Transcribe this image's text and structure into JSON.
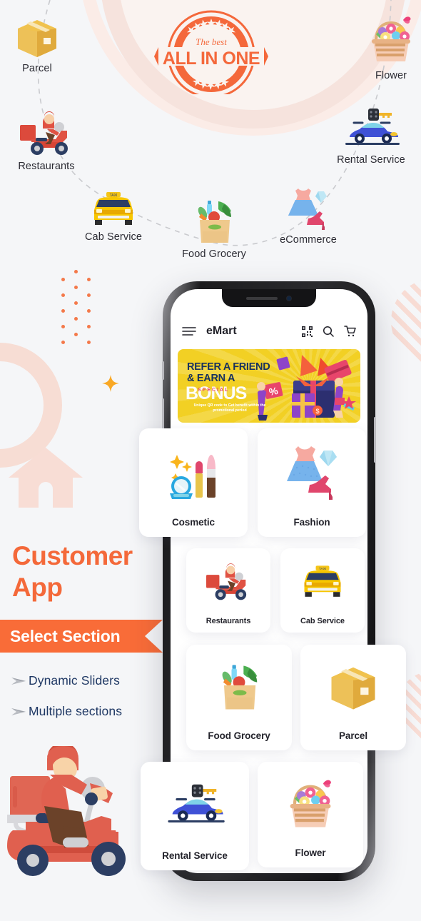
{
  "colors": {
    "accent_orange": "#f96c38",
    "heading_orange": "#f4693a",
    "bullet_blue": "#1f3864",
    "banner_yellow": "#f2d024",
    "page_bg": "#f5f6f8",
    "deco_pink": "#f7ddd4",
    "star_yellow": "#f9a825"
  },
  "badge": {
    "top_text": "The best",
    "main_text": "ALL IN ONE"
  },
  "services": [
    {
      "key": "parcel",
      "label": "Parcel",
      "icon": "parcel-box-icon"
    },
    {
      "key": "rest",
      "label": "Restaurants",
      "icon": "delivery-scooter-icon"
    },
    {
      "key": "cab",
      "label": "Cab Service",
      "icon": "taxi-car-icon"
    },
    {
      "key": "grocery",
      "label": "Food Grocery",
      "icon": "grocery-bag-icon"
    },
    {
      "key": "ecom",
      "label": "eCommerce",
      "icon": "dress-heel-diamond-icon"
    },
    {
      "key": "flower",
      "label": "Flower",
      "icon": "flower-basket-icon"
    },
    {
      "key": "rental",
      "label": "Rental Service",
      "icon": "car-key-icon"
    }
  ],
  "promo": {
    "title_line1": "Customer",
    "title_line2": "App",
    "ribbon_label": "Select Section",
    "bullets": [
      {
        "label": "Dynamic Sliders",
        "marker": "arrow-bullet-icon"
      },
      {
        "label": "Multiple sections",
        "marker": "arrow-bullet-icon"
      }
    ]
  },
  "phone": {
    "app_bar": {
      "menu_icon": "hamburger-menu-icon",
      "brand": "eMart",
      "qr_icon": "qr-scan-icon",
      "search_icon": "search-icon",
      "cart_icon": "shopping-cart-icon"
    },
    "banner": {
      "line1": "REFER A FRIEND",
      "line2": "& EARN A",
      "bonus": "BONUS",
      "special": "SPECIAL",
      "subtext": "Unique QR code to Get benefit within the promotional period"
    },
    "cards": [
      {
        "key": "cosmetic",
        "label": "Cosmetic",
        "icon": "cosmetic-makeup-icon"
      },
      {
        "key": "fashion",
        "label": "Fashion",
        "icon": "dress-heel-diamond-icon"
      },
      {
        "key": "rest",
        "label": "Restaurants",
        "icon": "delivery-scooter-icon"
      },
      {
        "key": "cab",
        "label": "Cab Service",
        "icon": "taxi-car-icon"
      },
      {
        "key": "grocery",
        "label": "Food Grocery",
        "icon": "grocery-bag-icon"
      },
      {
        "key": "parcel",
        "label": "Parcel",
        "icon": "parcel-box-icon"
      },
      {
        "key": "rental",
        "label": "Rental Service",
        "icon": "car-key-icon"
      },
      {
        "key": "flower",
        "label": "Flower",
        "icon": "flower-basket-icon"
      }
    ]
  }
}
